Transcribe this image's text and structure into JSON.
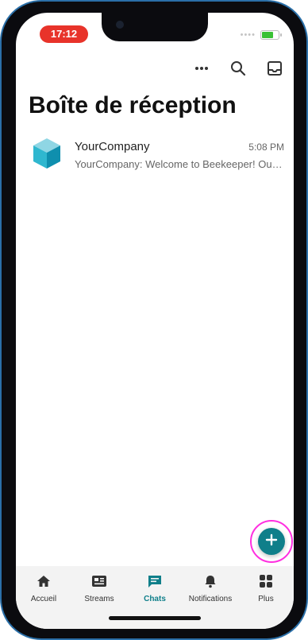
{
  "status_bar": {
    "time": "17:12",
    "battery_color": "#39c134"
  },
  "toolbar": {
    "more_icon": "more-horizontal-icon",
    "search_icon": "search-icon",
    "inbox_icon": "inbox-icon"
  },
  "page": {
    "title": "Boîte de réception"
  },
  "chats": [
    {
      "name": "YourCompany",
      "time": "5:08 PM",
      "preview": "YourCompany: Welcome to Beekeeper! Our goal is to connect every worker",
      "avatar_icon": "cube-logo-icon"
    }
  ],
  "fab": {
    "icon": "plus-icon",
    "color": "#0f7f8a"
  },
  "tabs": [
    {
      "label": "Accueil",
      "icon": "home-icon"
    },
    {
      "label": "Streams",
      "icon": "streams-icon"
    },
    {
      "label": "Chats",
      "icon": "chat-icon",
      "active": true
    },
    {
      "label": "Notifications",
      "icon": "bell-icon"
    },
    {
      "label": "Plus",
      "icon": "grid-icon"
    }
  ],
  "accent_color": "#0f7f8a"
}
